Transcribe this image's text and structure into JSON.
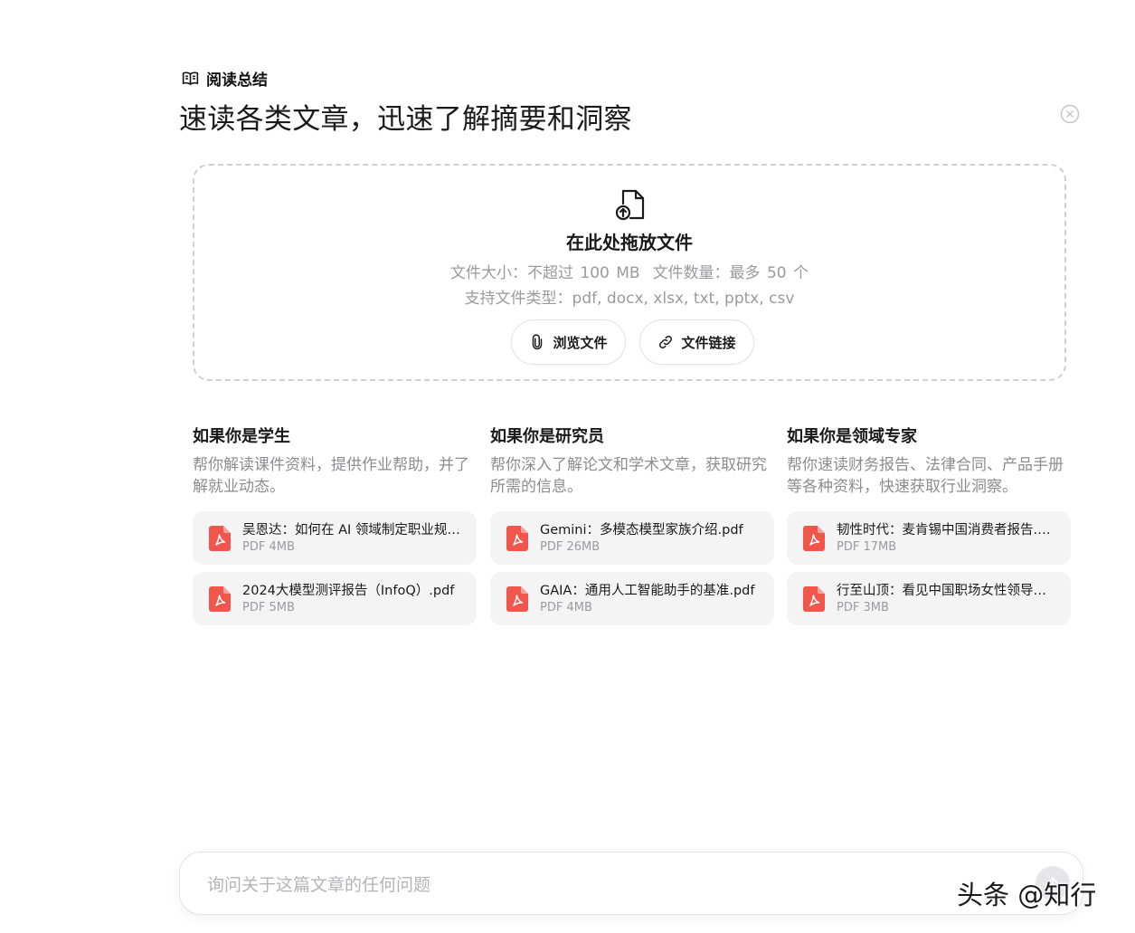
{
  "tool": {
    "label": "阅读总结",
    "icon": "open-book-icon"
  },
  "headline": "速读各类文章，迅速了解摘要和洞察",
  "dropzone": {
    "title": "在此处拖放文件",
    "size_limit": "文件大小：不超过 100 MB",
    "count_limit": "文件数量：最多 50 个",
    "types": "支持文件类型：pdf, docx, xlsx, txt, pptx, csv",
    "browse_label": "浏览文件",
    "link_label": "文件链接"
  },
  "columns": [
    {
      "title": "如果你是学生",
      "desc": "帮你解读课件资料，提供作业帮助，并了解就业动态。",
      "files": [
        {
          "name": "吴恩达：如何在 AI 领域制定职业规划.pdf",
          "meta": "PDF 4MB"
        },
        {
          "name": "2024大模型测评报告（InfoQ）.pdf",
          "meta": "PDF 5MB"
        }
      ]
    },
    {
      "title": "如果你是研究员",
      "desc": "帮你深入了解论文和学术文章，获取研究所需的信息。",
      "files": [
        {
          "name": "Gemini：多模态模型家族介绍.pdf",
          "meta": "PDF 26MB"
        },
        {
          "name": "GAIA：通用人工智能助手的基准.pdf",
          "meta": "PDF 4MB"
        }
      ]
    },
    {
      "title": "如果你是领域专家",
      "desc": "帮你速读财务报告、法律合同、产品手册等各种资料，快速获取行业洞察。",
      "files": [
        {
          "name": "韧性时代：麦肯锡中国消费者报告.pdf",
          "meta": "PDF 17MB"
        },
        {
          "name": "行至山顶：看见中国职场女性领导力.pdf",
          "meta": "PDF 3MB"
        }
      ]
    }
  ],
  "chat": {
    "placeholder": "询问关于这篇文章的任何问题"
  },
  "watermark": "头条 @知行",
  "colors": {
    "pdf_red": "#f0564b",
    "border": "#cfcfd4",
    "muted_text": "#9a9aa0"
  }
}
